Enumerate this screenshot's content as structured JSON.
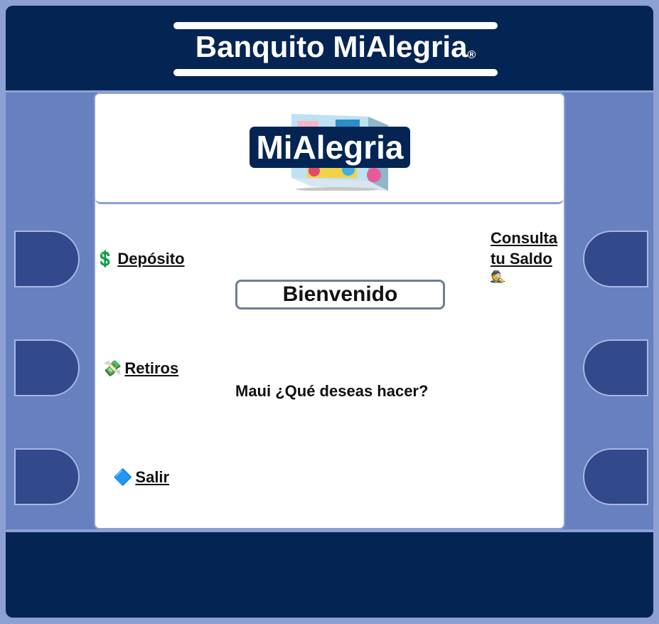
{
  "header": {
    "title": "Banquito MiAlegria",
    "registered_mark": "®"
  },
  "logo": {
    "label": "MiAlegria"
  },
  "menu": {
    "deposit": {
      "icon": "dollar-sign-icon",
      "glyph": "💲",
      "label": "Depósito"
    },
    "withdraw": {
      "icon": "money-with-wings-icon",
      "glyph": "💸",
      "label": "Retiros"
    },
    "exit": {
      "icon": "blue-diamond-icon",
      "glyph": "🔷",
      "label": "Salir"
    },
    "balance": {
      "line1": "Consulta",
      "line2": "tu Saldo",
      "icon": "detective-icon",
      "glyph": "🕵"
    }
  },
  "welcome": {
    "label": "Bienvenido",
    "question": "Maui ¿Qué deseas hacer?"
  },
  "colors": {
    "navy": "#042454",
    "panel_blue": "#6680c0",
    "button_blue": "#324a8c",
    "light_border": "#8da0d4"
  }
}
